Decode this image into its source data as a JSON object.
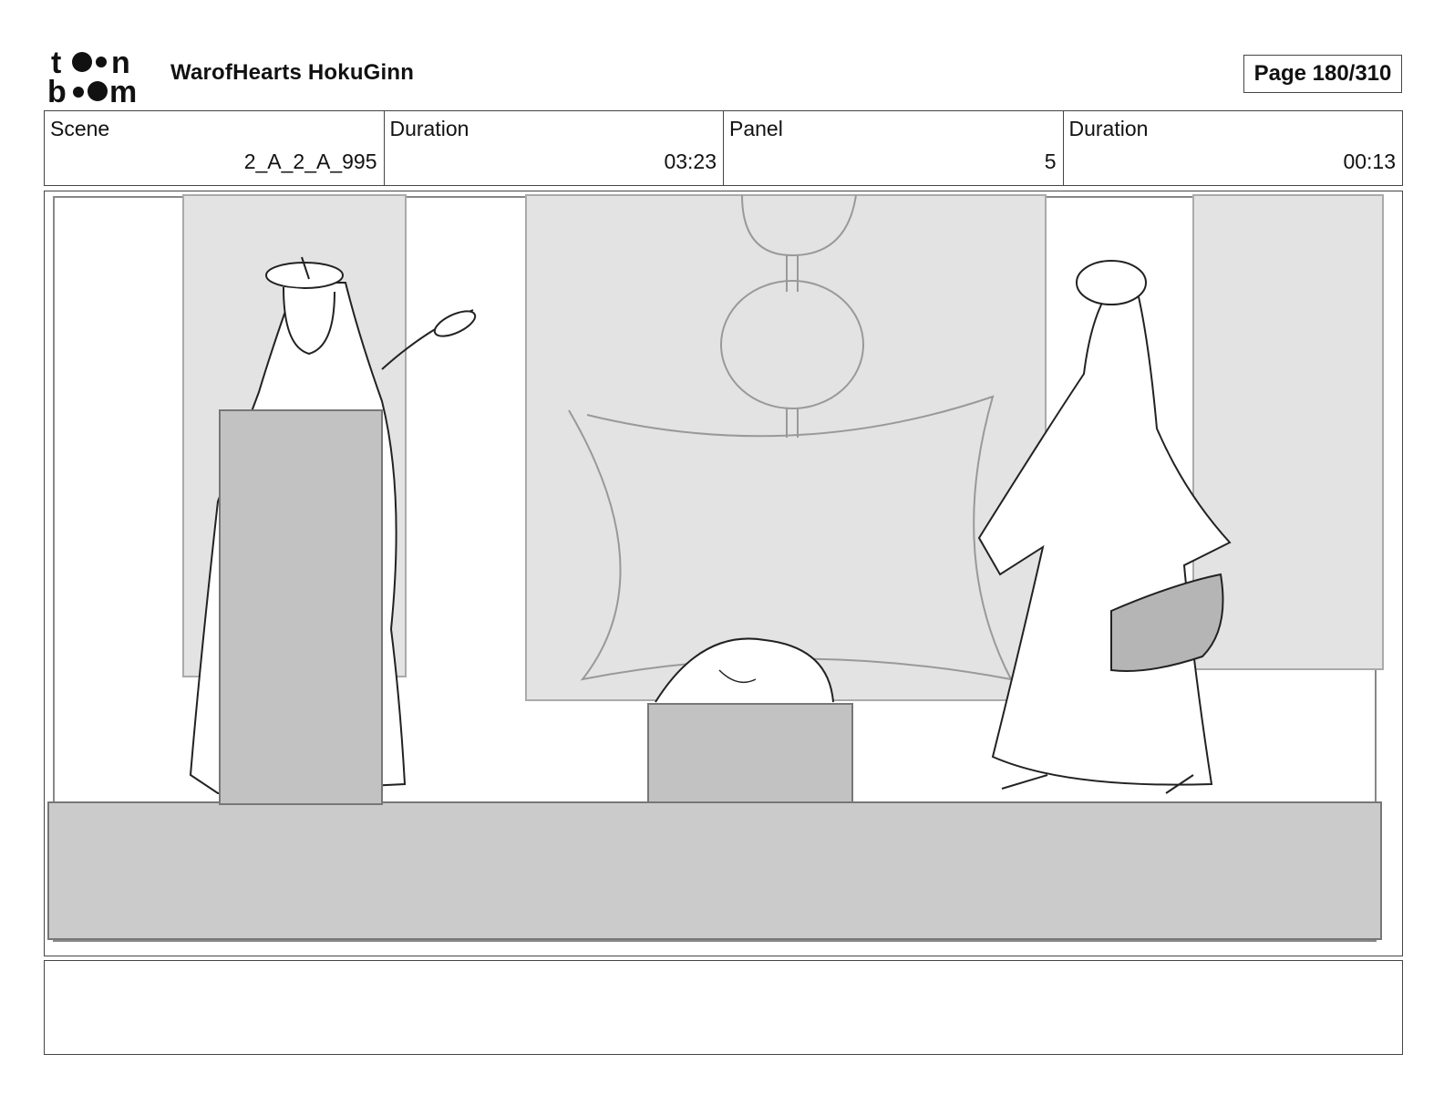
{
  "header": {
    "logo_text": "toon boom",
    "project_title": "WarofHearts HokuGinn",
    "page_label": "Page 180/310"
  },
  "info": {
    "scene_label": "Scene",
    "scene_value": "2_A_2_A_995",
    "scene_duration_label": "Duration",
    "scene_duration_value": "03:23",
    "panel_label": "Panel",
    "panel_value": "5",
    "panel_duration_label": "Duration",
    "panel_duration_value": "00:13"
  },
  "notes": {
    "text": ""
  }
}
